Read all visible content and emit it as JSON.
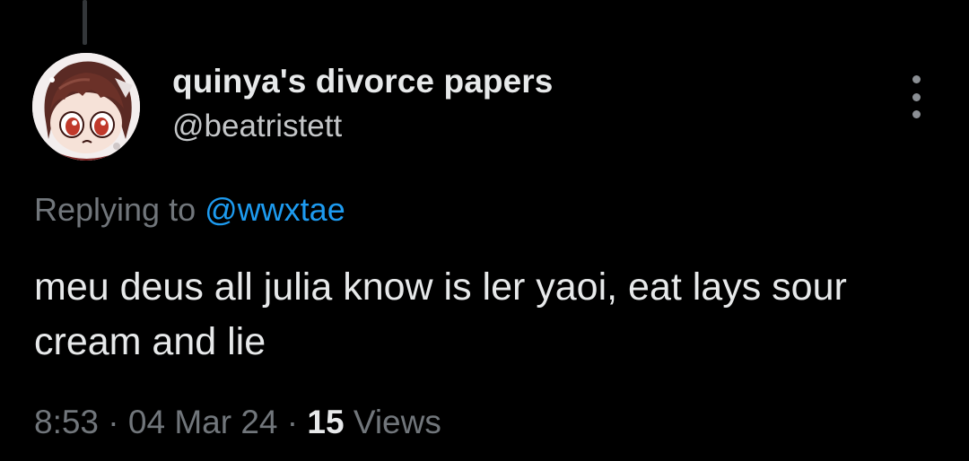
{
  "author": {
    "display_name": "quinya's divorce papers",
    "handle": "@beatristett"
  },
  "reply": {
    "prefix": "Replying to",
    "mention": "@wwxtae"
  },
  "tweet": {
    "text": "meu deus all julia know is ler yaoi, eat lays sour cream and lie"
  },
  "meta": {
    "time": "8:53",
    "separator": "·",
    "date": "04 Mar 24",
    "views_count": "15",
    "views_label": "Views"
  },
  "icons": {
    "more": "more-vertical-icon",
    "avatar": "avatar-image"
  },
  "colors": {
    "background": "#000000",
    "primary_text": "#e7e9ea",
    "secondary_text": "#71767b",
    "link": "#1d9bf0"
  }
}
